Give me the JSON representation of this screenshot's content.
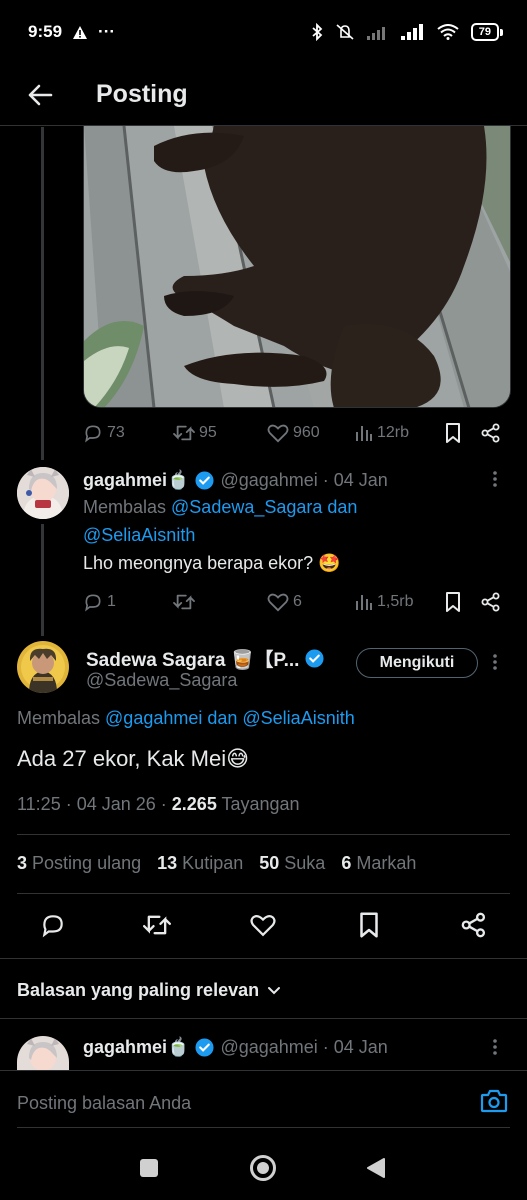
{
  "status_bar": {
    "time": "9:59",
    "warning_icon": "warning-icon",
    "more": "···",
    "battery": "79"
  },
  "header": {
    "title": "Posting"
  },
  "parent_tweet_actions": {
    "replies": "73",
    "reposts": "95",
    "likes": "960",
    "views": "12rb"
  },
  "reply_tweet": {
    "name": "gagahmei🍵",
    "handle": "@gagahmei · 04 Jan",
    "reply_prefix": "Membalas ",
    "mention_line1": "@Sadewa_Sagara dan",
    "mention_line2": "@SeliaAisnith",
    "text": "Lho meongnya berapa ekor? 🤩",
    "replies": "1",
    "reposts": "",
    "likes": "6",
    "views": "1,5rb"
  },
  "main_tweet": {
    "name": "Sadewa Sagara 🥃【P...",
    "handle": "@Sadewa_Sagara",
    "follow_label": "Mengikuti",
    "reply_prefix": "Membalas ",
    "mentions": "@gagahmei dan @SeliaAisnith",
    "text": "Ada 27 ekor, Kak Mei😅",
    "time": "11:25 · 04 Jan 26 · ",
    "views_count": "2.265",
    "views_label": " Tayangan"
  },
  "stats": {
    "reposts_count": "3",
    "reposts_label": "Posting ulang",
    "quotes_count": "13",
    "quotes_label": "Kutipan",
    "likes_count": "50",
    "likes_label": "Suka",
    "bookmarks_count": "6",
    "bookmarks_label": "Markah"
  },
  "replies_section": {
    "sort_label": "Balasan yang paling relevan"
  },
  "next_reply": {
    "name": "gagahmei🍵",
    "handle": "@gagahmei · 04 Jan"
  },
  "reply_bar": {
    "placeholder": "Posting balasan Anda"
  },
  "colors": {
    "background": "#000000",
    "text": "#e7e9ea",
    "muted": "#71767b",
    "accent": "#1d9bf0",
    "divider": "#2f3336"
  }
}
